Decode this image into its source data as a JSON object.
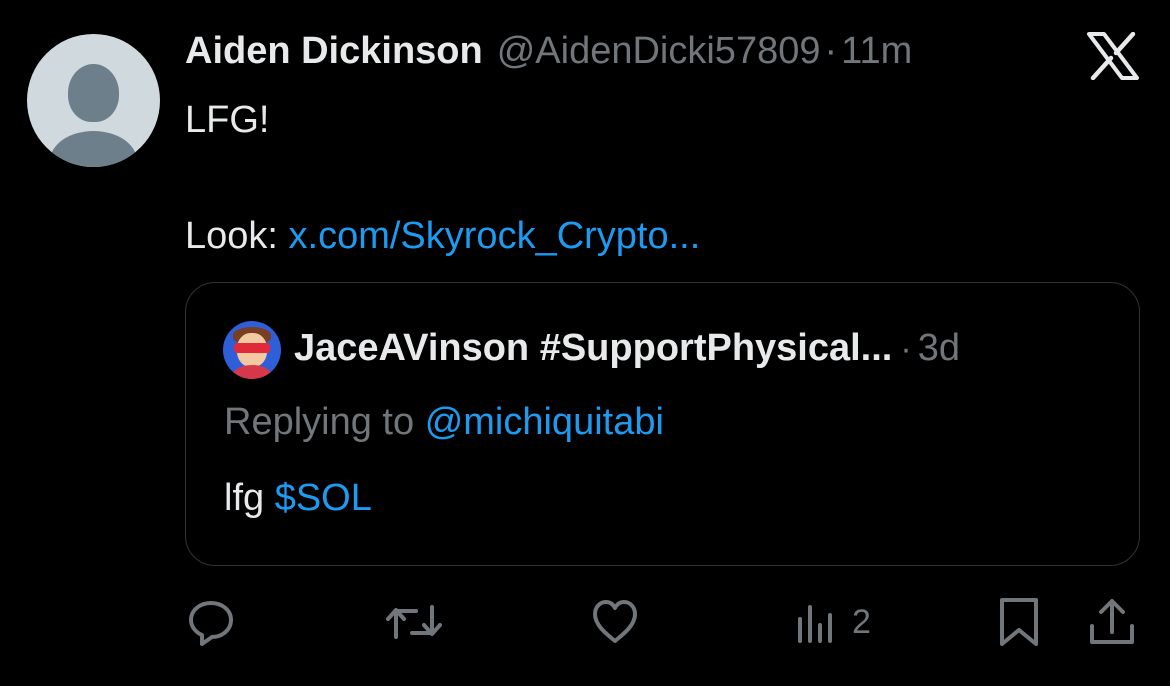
{
  "tweet": {
    "author_name": "Aiden Dickinson",
    "handle": "@AidenDicki57809",
    "separator": "·",
    "time": "11m",
    "text_line1": "LFG!",
    "text_prefix": "Look:",
    "link_text": "x.com/Skyrock_Crypto..."
  },
  "quote": {
    "author_name": "JaceAVinson #SupportPhysical...",
    "separator": "·",
    "time": "3d",
    "replying_prefix": "Replying to",
    "replying_handle": "@michiquitabi",
    "text_word": "lfg",
    "cashtag": "$SOL"
  },
  "actions": {
    "reply_icon": "reply-icon",
    "retweet_icon": "retweet-icon",
    "like_icon": "heart-icon",
    "views_icon": "views-icon",
    "views_count": "2",
    "bookmark_icon": "bookmark-icon",
    "share_icon": "share-icon"
  },
  "colors": {
    "background": "#000000",
    "text": "#e7e9ea",
    "muted": "#71767b",
    "link": "#1d9bf0",
    "border": "#2f3336"
  }
}
